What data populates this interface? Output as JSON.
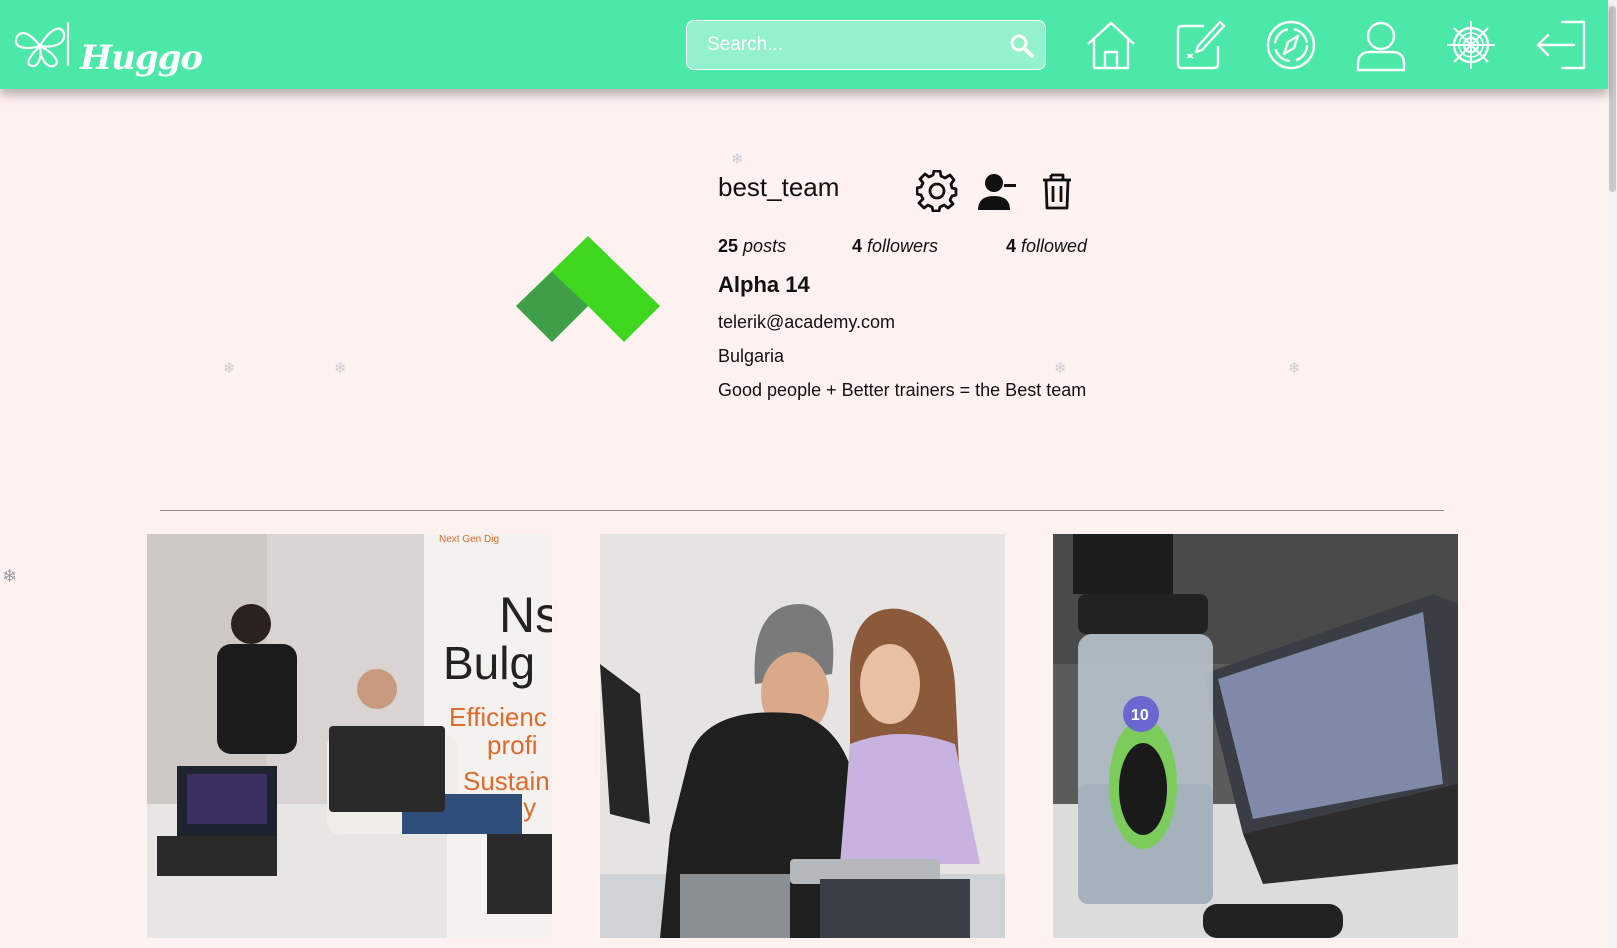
{
  "header": {
    "logo_text": "Huggo",
    "search_placeholder": "Search...",
    "nav_icons": [
      "home-icon",
      "create-post-icon",
      "explore-icon",
      "profile-icon",
      "settings-icon",
      "logout-icon"
    ]
  },
  "profile": {
    "username": "best_team",
    "actions": [
      "gear-icon",
      "follow-user-icon",
      "trash-icon"
    ],
    "stats": {
      "posts_count": "25",
      "posts_label": "posts",
      "followers_count": "4",
      "followers_label": "followers",
      "followed_count": "4",
      "followed_label": "followed"
    },
    "full_name": "Alpha 14",
    "email": "telerik@academy.com",
    "country": "Bulgaria",
    "bio": "Good people + Better trainers = the Best team"
  },
  "posts": {
    "poster_texts": [
      "Next Gen Dig",
      "Ns",
      "Bulg",
      "Efficienc",
      "profi",
      "Sustain",
      "d dy"
    ],
    "bottle_badge": "10"
  },
  "colors": {
    "header_bg": "#4be8a8",
    "page_bg": "#fff2f1",
    "avatar_green_light": "#3fd61f",
    "avatar_green_dark": "#3f9e48"
  }
}
